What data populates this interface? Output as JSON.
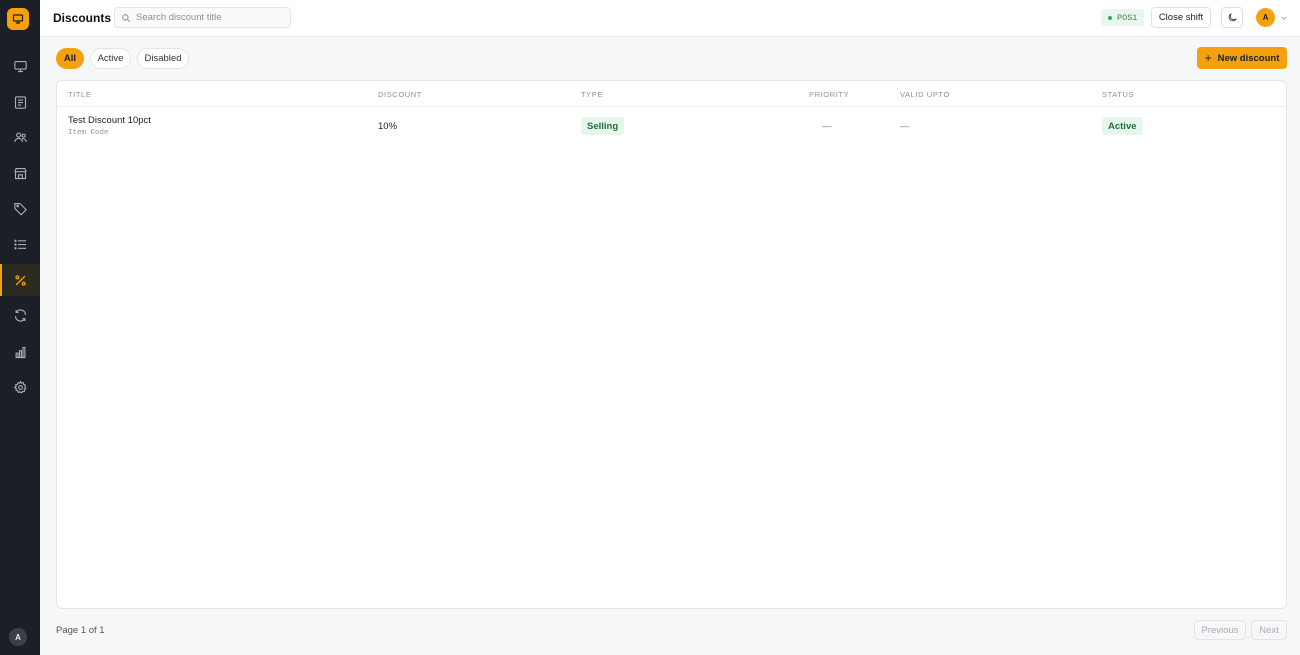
{
  "app": {
    "logo_icon": "monitor-icon",
    "user_initial": "A"
  },
  "sidebar": {
    "items": [
      {
        "icon": "monitor-icon",
        "id": "pos"
      },
      {
        "icon": "receipt-icon",
        "id": "orders"
      },
      {
        "icon": "users-icon",
        "id": "customers"
      },
      {
        "icon": "store-icon",
        "id": "stores"
      },
      {
        "icon": "tag-icon",
        "id": "tags"
      },
      {
        "icon": "list-icon",
        "id": "items"
      },
      {
        "icon": "percent-icon",
        "id": "discounts",
        "active": true
      },
      {
        "icon": "refresh-icon",
        "id": "sync"
      },
      {
        "icon": "bar-chart-icon",
        "id": "reports"
      },
      {
        "icon": "gear-icon",
        "id": "settings"
      }
    ]
  },
  "header": {
    "title": "Discounts",
    "search_placeholder": "Search discount title",
    "pos_label": "POS1",
    "close_shift_label": "Close shift",
    "user_initial": "A"
  },
  "filters": {
    "all": "All",
    "active": "Active",
    "disabled": "Disabled",
    "selected": "All"
  },
  "new_button_label": "New discount",
  "table": {
    "columns": {
      "title": "TITLE",
      "discount": "DISCOUNT",
      "type": "TYPE",
      "priority": "PRIORITY",
      "valid_upto": "VALID UPTO",
      "status": "STATUS"
    },
    "rows": [
      {
        "title": "Test Discount 10pct",
        "subtitle": "Item Code",
        "discount": "10%",
        "type": "Selling",
        "priority": "—",
        "valid_upto": "—",
        "status": "Active"
      }
    ]
  },
  "pagination": {
    "info": "Page 1 of 1",
    "previous": "Previous",
    "next": "Next"
  },
  "colors": {
    "accent": "#f5a00f",
    "sidebar_bg": "#1b1f27",
    "success_bg": "#e8f5ec",
    "success_text": "#20703f"
  }
}
